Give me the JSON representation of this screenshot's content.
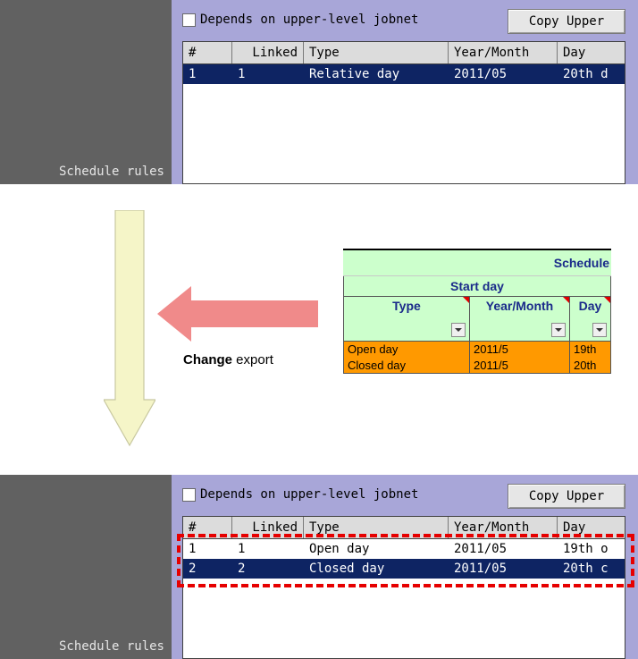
{
  "before": {
    "sidebar_label": "Schedule rules",
    "depends_label": "Depends on upper-level jobnet",
    "copy_button": "Copy Upper",
    "columns": [
      "#",
      "Linked",
      "Type",
      "Year/Month",
      "Day"
    ],
    "rows": [
      {
        "num": "1",
        "linked": "1",
        "type": "Relative day",
        "ym": "2011/05",
        "day": "20th d",
        "selected": true
      }
    ]
  },
  "after": {
    "sidebar_label": "Schedule rules",
    "depends_label": "Depends on upper-level jobnet",
    "copy_button": "Copy Upper",
    "columns": [
      "#",
      "Linked",
      "Type",
      "Year/Month",
      "Day"
    ],
    "rows": [
      {
        "num": "1",
        "linked": "1",
        "type": "Open day",
        "ym": "2011/05",
        "day": "19th o",
        "selected": false
      },
      {
        "num": "2",
        "linked": "2",
        "type": "Closed day",
        "ym": "2011/05",
        "day": "20th c",
        "selected": true
      }
    ]
  },
  "spreadsheet": {
    "title": "Schedule",
    "group": "Start day",
    "headers": [
      "Type",
      "Year/Month",
      "Day"
    ],
    "rows": [
      [
        "Open day",
        "2011/5",
        "19th"
      ],
      [
        "Closed day",
        "2011/5",
        "20th"
      ]
    ]
  },
  "caption": {
    "bold": "Change",
    "rest": " export"
  },
  "colors": {
    "selection": "#0e2463",
    "panel": "#a8a6d8",
    "sidebar": "#616161",
    "highlight": "#e60000",
    "sheet_header": "#ccffcc",
    "sheet_rows": "#ff9900",
    "arrow_left": "#f08a8a",
    "arrow_down": "#f5f5c8"
  }
}
